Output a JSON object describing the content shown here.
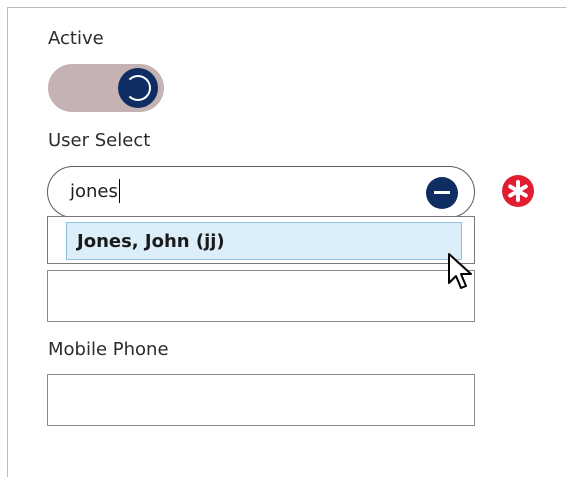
{
  "form": {
    "active_label": "Active",
    "active_value": true,
    "user_select_label": "User Select",
    "user_select_value": "jones",
    "suggestion": "Jones, John (jj)",
    "unlabeled_field_value": "",
    "mobile_phone_label": "Mobile Phone",
    "mobile_phone_value": ""
  },
  "colors": {
    "accent": "#0e2d63",
    "toggle_track": "#c5b3b3",
    "required": "#e01e2f",
    "highlight": "#dbeef9"
  },
  "icons": {
    "toggle_knob": "power-icon",
    "clear": "minus-circle-icon",
    "required": "asterisk-icon",
    "pointer": "mouse-pointer-icon"
  }
}
